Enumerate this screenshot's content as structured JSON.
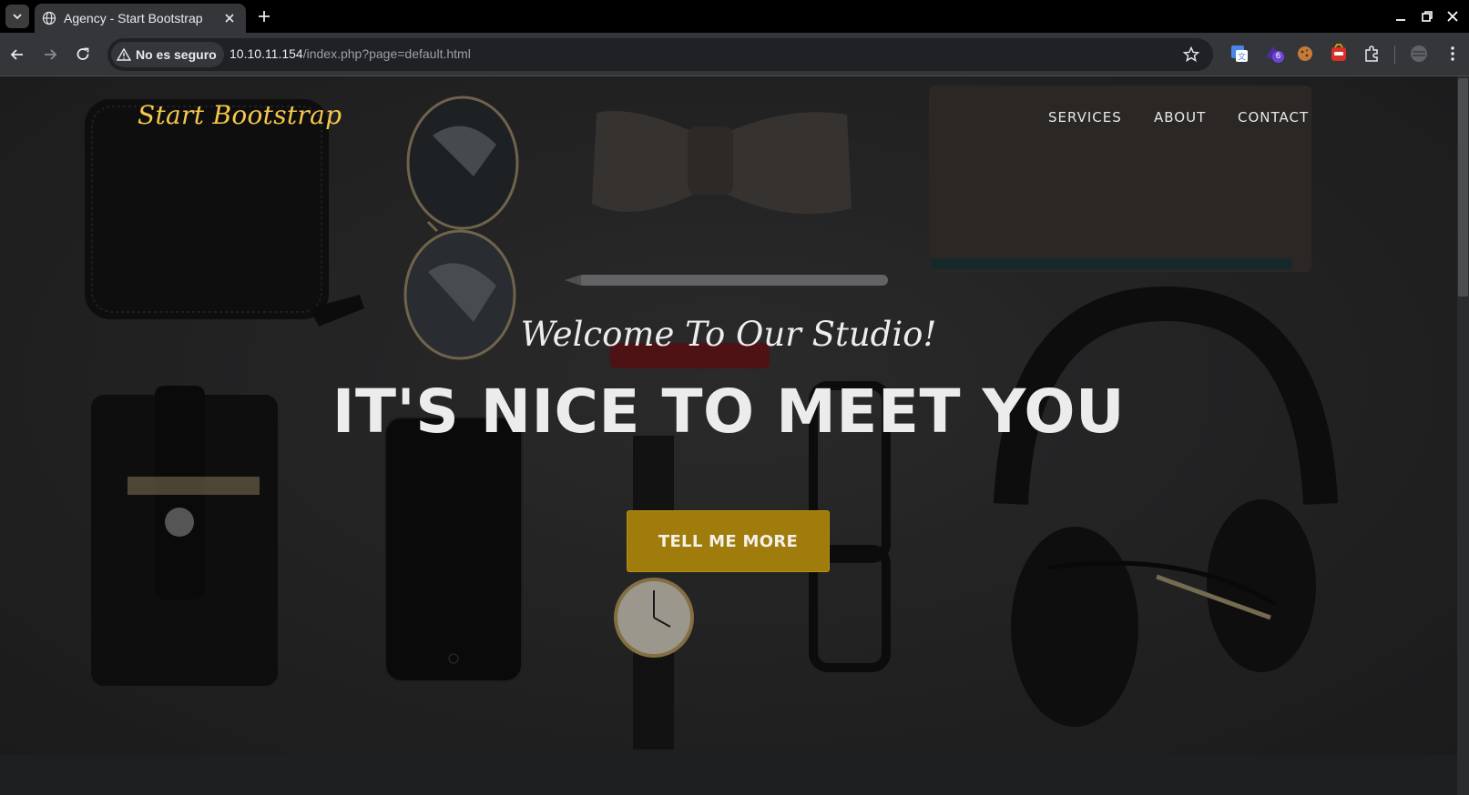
{
  "browser": {
    "tab_title": "Agency - Start Bootstrap",
    "security_label": "No es seguro",
    "url_host": "10.10.11.154",
    "url_path": "/index.php?page=default.html",
    "extension_badge": "6"
  },
  "site": {
    "brand": "Start Bootstrap",
    "nav": [
      "SERVICES",
      "ABOUT",
      "CONTACT"
    ],
    "welcome": "Welcome To Our Studio!",
    "headline": "IT'S NICE TO MEET YOU",
    "cta": "TELL ME MORE"
  },
  "colors": {
    "accent": "#a07c0c",
    "brand_text": "#f6c84b",
    "hero_bg": "#2f2f30"
  }
}
